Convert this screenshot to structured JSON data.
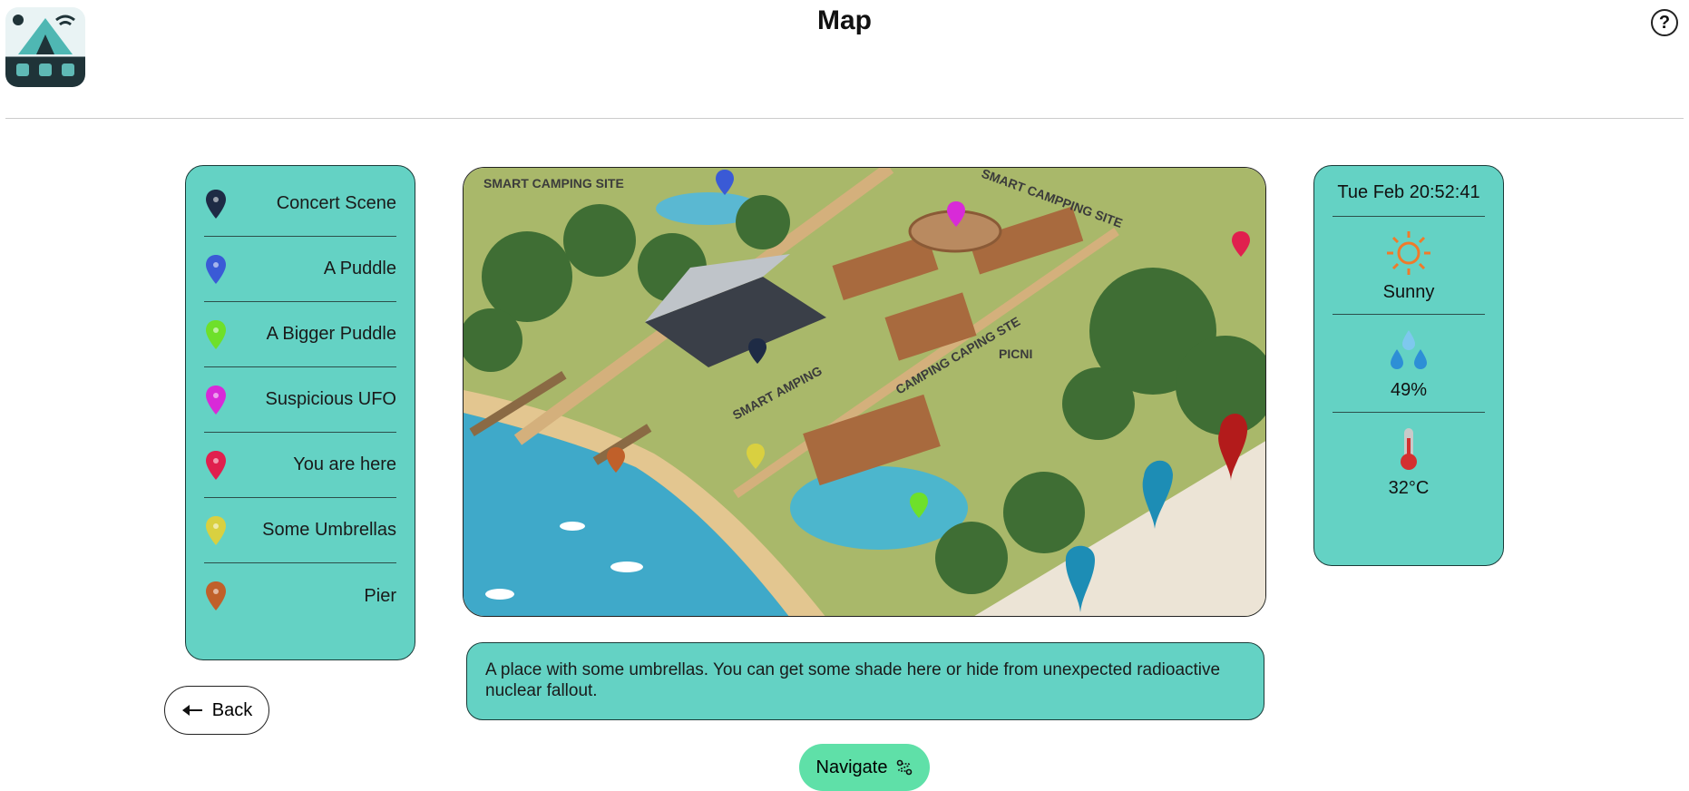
{
  "header": {
    "title": "Map",
    "help_label": "?"
  },
  "legend": {
    "items": [
      {
        "label": "Concert Scene",
        "color": "#1e2b45",
        "icon": "location-pin-icon"
      },
      {
        "label": "A Puddle",
        "color": "#3a5ad6",
        "icon": "location-pin-icon"
      },
      {
        "label": "A Bigger Puddle",
        "color": "#6ee02a",
        "icon": "location-pin-icon"
      },
      {
        "label": "Suspicious UFO",
        "color": "#d82ad8",
        "icon": "location-pin-icon"
      },
      {
        "label": "You are here",
        "color": "#e0204e",
        "icon": "location-pin-icon"
      },
      {
        "label": "Some Umbrellas",
        "color": "#d9d040",
        "icon": "location-pin-icon"
      },
      {
        "label": "Pier",
        "color": "#c0602a",
        "icon": "location-pin-icon"
      }
    ]
  },
  "map": {
    "labels": [
      "SMART CAMPING SITE",
      "SMART CAMPPING SITE",
      "SMART AMPING",
      "CAMPING CAPING STE",
      "PICNI"
    ]
  },
  "weather": {
    "datetime": "Tue Feb 20:52:41",
    "condition": "Sunny",
    "humidity": "49%",
    "temperature": "32°C",
    "accent_color": "#f07a2a"
  },
  "description": "A place with some umbrellas. You can get some shade here or hide from unexpected radioactive nuclear fallout.",
  "buttons": {
    "back": "Back",
    "navigate": "Navigate"
  },
  "colors": {
    "panel": "#64d2c4",
    "navigate": "#5fe0a8"
  }
}
